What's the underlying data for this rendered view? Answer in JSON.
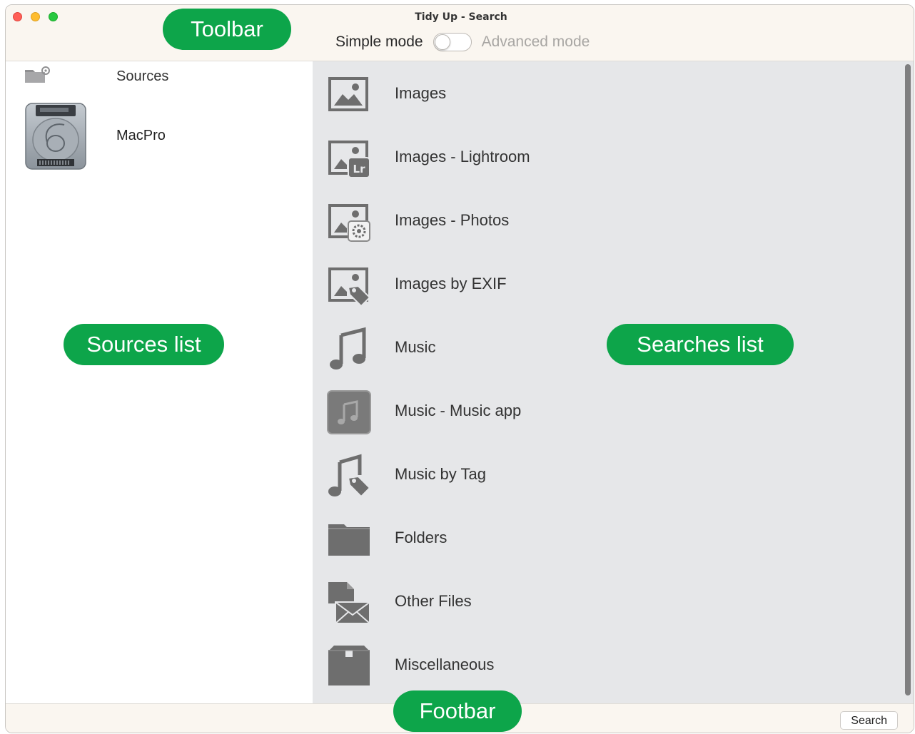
{
  "window": {
    "title": "Tidy Up - Search",
    "traffic_lights": [
      "close",
      "minimize",
      "zoom"
    ]
  },
  "toolbar": {
    "simple_mode_label": "Simple mode",
    "advanced_mode_label": "Advanced mode",
    "mode_toggle_on": false
  },
  "sources": {
    "header_label": "Sources",
    "header_icon": "folder-gear-icon",
    "items": [
      {
        "label": "MacPro",
        "icon": "hard-disk-icon"
      }
    ]
  },
  "searches": {
    "items": [
      {
        "label": "Images",
        "icon": "image-icon"
      },
      {
        "label": "Images - Lightroom",
        "icon": "image-lightroom-icon"
      },
      {
        "label": "Images - Photos",
        "icon": "image-photos-icon"
      },
      {
        "label": "Images by EXIF",
        "icon": "image-tag-icon"
      },
      {
        "label": "Music",
        "icon": "music-note-icon"
      },
      {
        "label": "Music - Music app",
        "icon": "music-app-icon"
      },
      {
        "label": "Music by Tag",
        "icon": "music-tag-icon"
      },
      {
        "label": "Folders",
        "icon": "folder-icon"
      },
      {
        "label": "Other Files",
        "icon": "document-envelope-icon"
      },
      {
        "label": "Miscellaneous",
        "icon": "box-icon"
      }
    ]
  },
  "footbar": {
    "search_button_label": "Search"
  },
  "annotations": {
    "toolbar": "Toolbar",
    "sources_list": "Sources list",
    "searches_list": "Searches list",
    "footbar": "Footbar"
  },
  "colors": {
    "annotation_green": "#0da54a",
    "chrome_bg": "#faf6f0",
    "searches_bg": "#e6e7e9",
    "icon_gray": "#6e6e6e"
  }
}
